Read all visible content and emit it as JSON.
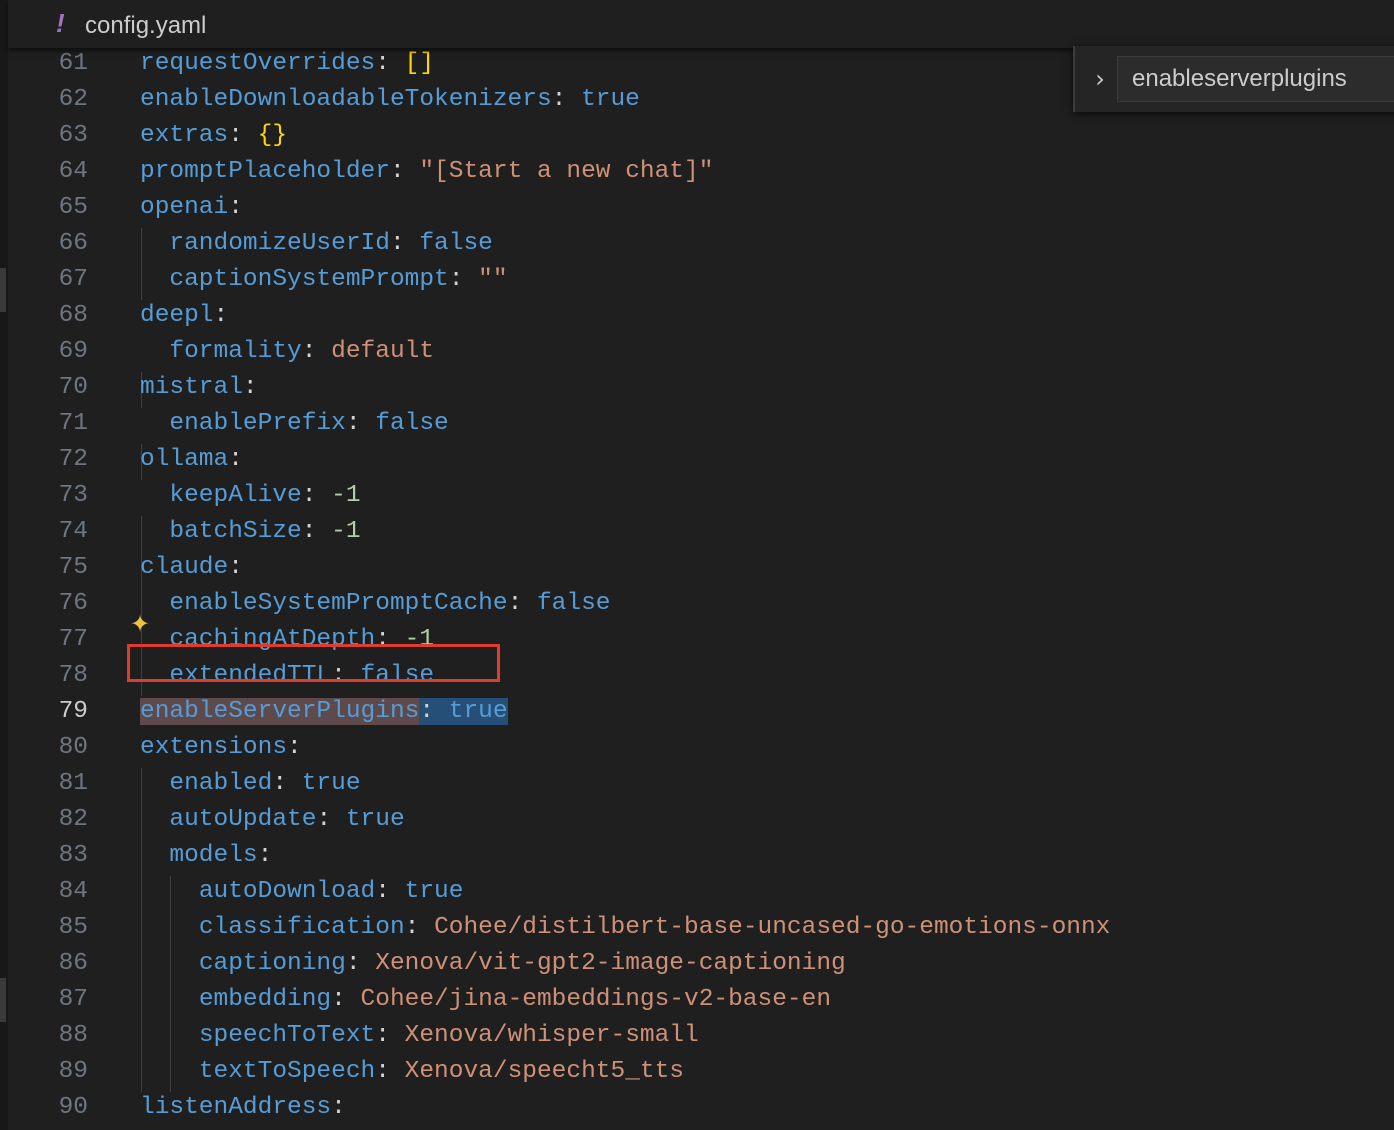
{
  "tab": {
    "icon": "!",
    "file_name": "config.yaml"
  },
  "find": {
    "query": "enableserverplugins"
  },
  "colors": {
    "highlight_border": "#e03c2a",
    "key": "#569cd6",
    "string": "#ce9178",
    "number": "#b5cea8"
  },
  "lines": [
    {
      "num": "61",
      "tokens": [
        [
          "key",
          "requestOverrides"
        ],
        [
          "punc",
          ": "
        ],
        [
          "bracket",
          "[]"
        ]
      ]
    },
    {
      "num": "62",
      "tokens": [
        [
          "key",
          "enableDownloadableTokenizers"
        ],
        [
          "punc",
          ": "
        ],
        [
          "bool",
          "true"
        ]
      ]
    },
    {
      "num": "63",
      "tokens": [
        [
          "key",
          "extras"
        ],
        [
          "punc",
          ": "
        ],
        [
          "bracket",
          "{}"
        ]
      ]
    },
    {
      "num": "64",
      "tokens": [
        [
          "key",
          "promptPlaceholder"
        ],
        [
          "punc",
          ": "
        ],
        [
          "str",
          "\"[Start a new chat]\""
        ]
      ]
    },
    {
      "num": "65",
      "tokens": [
        [
          "key",
          "openai"
        ],
        [
          "punc",
          ":"
        ]
      ]
    },
    {
      "num": "66",
      "tokens": [
        [
          "punc",
          "  "
        ],
        [
          "key",
          "randomizeUserId"
        ],
        [
          "punc",
          ": "
        ],
        [
          "bool",
          "false"
        ]
      ]
    },
    {
      "num": "67",
      "tokens": [
        [
          "punc",
          "  "
        ],
        [
          "key",
          "captionSystemPrompt"
        ],
        [
          "punc",
          ": "
        ],
        [
          "str",
          "\"\""
        ]
      ]
    },
    {
      "num": "68",
      "tokens": [
        [
          "key",
          "deepl"
        ],
        [
          "punc",
          ":"
        ]
      ]
    },
    {
      "num": "69",
      "tokens": [
        [
          "punc",
          "  "
        ],
        [
          "key",
          "formality"
        ],
        [
          "punc",
          ": "
        ],
        [
          "str",
          "default"
        ]
      ]
    },
    {
      "num": "70",
      "tokens": [
        [
          "key",
          "mistral"
        ],
        [
          "punc",
          ":"
        ]
      ]
    },
    {
      "num": "71",
      "tokens": [
        [
          "punc",
          "  "
        ],
        [
          "key",
          "enablePrefix"
        ],
        [
          "punc",
          ": "
        ],
        [
          "bool",
          "false"
        ]
      ]
    },
    {
      "num": "72",
      "tokens": [
        [
          "key",
          "ollama"
        ],
        [
          "punc",
          ":"
        ]
      ]
    },
    {
      "num": "73",
      "tokens": [
        [
          "punc",
          "  "
        ],
        [
          "key",
          "keepAlive"
        ],
        [
          "punc",
          ": "
        ],
        [
          "num",
          "-1"
        ]
      ]
    },
    {
      "num": "74",
      "tokens": [
        [
          "punc",
          "  "
        ],
        [
          "key",
          "batchSize"
        ],
        [
          "punc",
          ": "
        ],
        [
          "num",
          "-1"
        ]
      ]
    },
    {
      "num": "75",
      "tokens": [
        [
          "key",
          "claude"
        ],
        [
          "punc",
          ":"
        ]
      ]
    },
    {
      "num": "76",
      "tokens": [
        [
          "punc",
          "  "
        ],
        [
          "key",
          "enableSystemPromptCache"
        ],
        [
          "punc",
          ": "
        ],
        [
          "bool",
          "false"
        ]
      ]
    },
    {
      "num": "77",
      "tokens": [
        [
          "punc",
          "  "
        ],
        [
          "key",
          "cachingAtDepth"
        ],
        [
          "punc",
          ": "
        ],
        [
          "num",
          "-1"
        ]
      ]
    },
    {
      "num": "78",
      "tokens": [
        [
          "punc",
          "  "
        ],
        [
          "key",
          "extendedTTL"
        ],
        [
          "punc",
          ": "
        ],
        [
          "bool",
          "false"
        ]
      ]
    },
    {
      "num": "79",
      "active": true,
      "tokens": [
        [
          "key sel-key",
          "enableServerPlugins"
        ],
        [
          "punc sel-val",
          ": "
        ],
        [
          "bool sel-val",
          "true"
        ]
      ]
    },
    {
      "num": "80",
      "tokens": [
        [
          "key",
          "extensions"
        ],
        [
          "punc",
          ":"
        ]
      ]
    },
    {
      "num": "81",
      "tokens": [
        [
          "punc",
          "  "
        ],
        [
          "key",
          "enabled"
        ],
        [
          "punc",
          ": "
        ],
        [
          "bool",
          "true"
        ]
      ]
    },
    {
      "num": "82",
      "tokens": [
        [
          "punc",
          "  "
        ],
        [
          "key",
          "autoUpdate"
        ],
        [
          "punc",
          ": "
        ],
        [
          "bool",
          "true"
        ]
      ]
    },
    {
      "num": "83",
      "tokens": [
        [
          "punc",
          "  "
        ],
        [
          "key",
          "models"
        ],
        [
          "punc",
          ":"
        ]
      ]
    },
    {
      "num": "84",
      "tokens": [
        [
          "punc",
          "    "
        ],
        [
          "key",
          "autoDownload"
        ],
        [
          "punc",
          ": "
        ],
        [
          "bool",
          "true"
        ]
      ]
    },
    {
      "num": "85",
      "tokens": [
        [
          "punc",
          "    "
        ],
        [
          "key",
          "classification"
        ],
        [
          "punc",
          ": "
        ],
        [
          "str",
          "Cohee/distilbert-base-uncased-go-emotions-onnx"
        ]
      ]
    },
    {
      "num": "86",
      "tokens": [
        [
          "punc",
          "    "
        ],
        [
          "key",
          "captioning"
        ],
        [
          "punc",
          ": "
        ],
        [
          "str",
          "Xenova/vit-gpt2-image-captioning"
        ]
      ]
    },
    {
      "num": "87",
      "tokens": [
        [
          "punc",
          "    "
        ],
        [
          "key",
          "embedding"
        ],
        [
          "punc",
          ": "
        ],
        [
          "str",
          "Cohee/jina-embeddings-v2-base-en"
        ]
      ]
    },
    {
      "num": "88",
      "tokens": [
        [
          "punc",
          "    "
        ],
        [
          "key",
          "speechToText"
        ],
        [
          "punc",
          ": "
        ],
        [
          "str",
          "Xenova/whisper-small"
        ]
      ]
    },
    {
      "num": "89",
      "tokens": [
        [
          "punc",
          "    "
        ],
        [
          "key",
          "textToSpeech"
        ],
        [
          "punc",
          ": "
        ],
        [
          "str",
          "Xenova/speecht5_tts"
        ]
      ]
    },
    {
      "num": "90",
      "tokens": [
        [
          "key",
          "listenAddress"
        ],
        [
          "punc",
          ":"
        ]
      ]
    }
  ]
}
